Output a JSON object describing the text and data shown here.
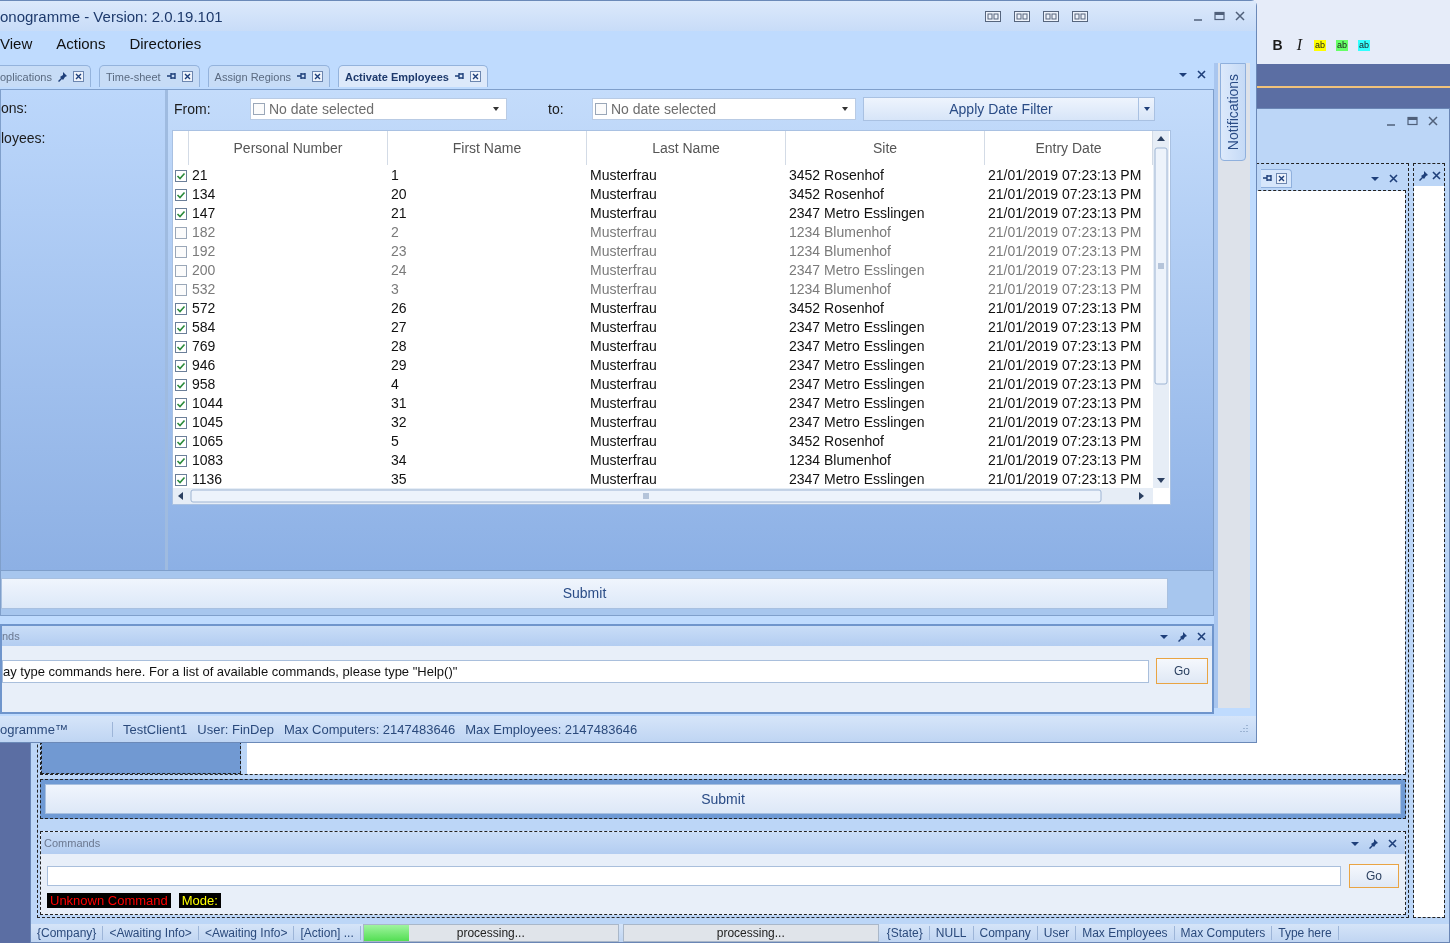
{
  "designer": {
    "toolbar": [
      {
        "kind": "bold",
        "label": "B"
      },
      {
        "kind": "italic",
        "label": "I"
      },
      {
        "kind": "highlight",
        "label": "ab",
        "color": "#ffff00"
      },
      {
        "kind": "highlight",
        "label": "ab",
        "color": "#66ff66"
      },
      {
        "kind": "highlight",
        "label": "ab",
        "color": "#33ffff"
      }
    ],
    "submit_button": "Submit",
    "commands": {
      "title": "Commands",
      "go_button": "Go",
      "messages": [
        {
          "text": "Unknown Command",
          "kind": "error"
        },
        {
          "text": "Mode:",
          "kind": "mode"
        }
      ]
    },
    "status_bar": [
      {
        "kind": "text",
        "text": "{Company}"
      },
      {
        "kind": "text",
        "text": "<Awaiting Info>"
      },
      {
        "kind": "text",
        "text": "<Awaiting Info>"
      },
      {
        "kind": "text",
        "text": "[Action] ..."
      },
      {
        "kind": "progress",
        "text": "processing...",
        "level": 0.18
      },
      {
        "kind": "progress",
        "text": "processing...",
        "level": 0
      },
      {
        "kind": "text",
        "text": "{State}"
      },
      {
        "kind": "text",
        "text": "NULL"
      },
      {
        "kind": "text",
        "text": "Company"
      },
      {
        "kind": "text",
        "text": "User"
      },
      {
        "kind": "text",
        "text": "Max Employees"
      },
      {
        "kind": "text",
        "text": "Max Computers"
      },
      {
        "kind": "text",
        "text": "Type here"
      }
    ]
  },
  "window": {
    "title": "onogramme - Version: 2.0.19.101",
    "menu": [
      "View",
      "Actions",
      "Directories"
    ],
    "tabs": [
      {
        "label": "oplications",
        "selected": false,
        "pinned": true
      },
      {
        "label": "Time-sheet",
        "selected": false,
        "pinned": false
      },
      {
        "label": "Assign Regions",
        "selected": false,
        "pinned": false
      },
      {
        "label": "Activate Employees",
        "selected": true,
        "pinned": false
      }
    ],
    "side_labels": [
      "ons:",
      "loyees:"
    ],
    "filter": {
      "from_label": "From:",
      "from": {
        "checked": false,
        "value": "No date selected"
      },
      "to_label": "to:",
      "to": {
        "checked": false,
        "value": "No date selected"
      },
      "apply_button": "Apply Date Filter"
    },
    "table": {
      "columns": [
        "Personal Number",
        "First Name",
        "Last Name",
        "Site",
        "Entry Date"
      ],
      "rows": [
        {
          "checked": true,
          "cells": [
            "21",
            "1",
            "Musterfrau",
            "3452 Rosenhof",
            "21/01/2019 07:23:13 PM"
          ]
        },
        {
          "checked": true,
          "cells": [
            "134",
            "20",
            "Musterfrau",
            "3452 Rosenhof",
            "21/01/2019 07:23:13 PM"
          ]
        },
        {
          "checked": true,
          "cells": [
            "147",
            "21",
            "Musterfrau",
            "2347 Metro Esslingen",
            "21/01/2019 07:23:13 PM"
          ]
        },
        {
          "checked": false,
          "cells": [
            "182",
            "2",
            "Musterfrau",
            "1234 Blumenhof",
            "21/01/2019 07:23:13 PM"
          ]
        },
        {
          "checked": false,
          "cells": [
            "192",
            "23",
            "Musterfrau",
            "1234 Blumenhof",
            "21/01/2019 07:23:13 PM"
          ]
        },
        {
          "checked": false,
          "cells": [
            "200",
            "24",
            "Musterfrau",
            "2347 Metro Esslingen",
            "21/01/2019 07:23:13 PM"
          ]
        },
        {
          "checked": false,
          "cells": [
            "532",
            "3",
            "Musterfrau",
            "1234 Blumenhof",
            "21/01/2019 07:23:13 PM"
          ]
        },
        {
          "checked": true,
          "cells": [
            "572",
            "26",
            "Musterfrau",
            "3452 Rosenhof",
            "21/01/2019 07:23:13 PM"
          ]
        },
        {
          "checked": true,
          "cells": [
            "584",
            "27",
            "Musterfrau",
            "2347 Metro Esslingen",
            "21/01/2019 07:23:13 PM"
          ]
        },
        {
          "checked": true,
          "cells": [
            "769",
            "28",
            "Musterfrau",
            "2347 Metro Esslingen",
            "21/01/2019 07:23:13 PM"
          ]
        },
        {
          "checked": true,
          "cells": [
            "946",
            "29",
            "Musterfrau",
            "2347 Metro Esslingen",
            "21/01/2019 07:23:13 PM"
          ]
        },
        {
          "checked": true,
          "cells": [
            "958",
            "4",
            "Musterfrau",
            "2347 Metro Esslingen",
            "21/01/2019 07:23:13 PM"
          ]
        },
        {
          "checked": true,
          "cells": [
            "1044",
            "31",
            "Musterfrau",
            "2347 Metro Esslingen",
            "21/01/2019 07:23:13 PM"
          ]
        },
        {
          "checked": true,
          "cells": [
            "1045",
            "32",
            "Musterfrau",
            "2347 Metro Esslingen",
            "21/01/2019 07:23:13 PM"
          ]
        },
        {
          "checked": true,
          "cells": [
            "1065",
            "5",
            "Musterfrau",
            "3452 Rosenhof",
            "21/01/2019 07:23:13 PM"
          ]
        },
        {
          "checked": true,
          "cells": [
            "1083",
            "34",
            "Musterfrau",
            "1234 Blumenhof",
            "21/01/2019 07:23:13 PM"
          ]
        },
        {
          "checked": true,
          "cells": [
            "1136",
            "35",
            "Musterfrau",
            "2347 Metro Esslingen",
            "21/01/2019 07:23:13 PM"
          ]
        }
      ]
    },
    "submit_button": "Submit",
    "notifications_tab": "Notifications",
    "commands": {
      "title": "nds",
      "value": "ay type commands here. For a list of available commands, please type \"Help()\"",
      "go_button": "Go"
    },
    "status_bar": [
      "ogramme™",
      "TestClient1",
      "User: FinDep",
      "Max Computers: 2147483646",
      "Max Employees: 2147483646"
    ]
  }
}
